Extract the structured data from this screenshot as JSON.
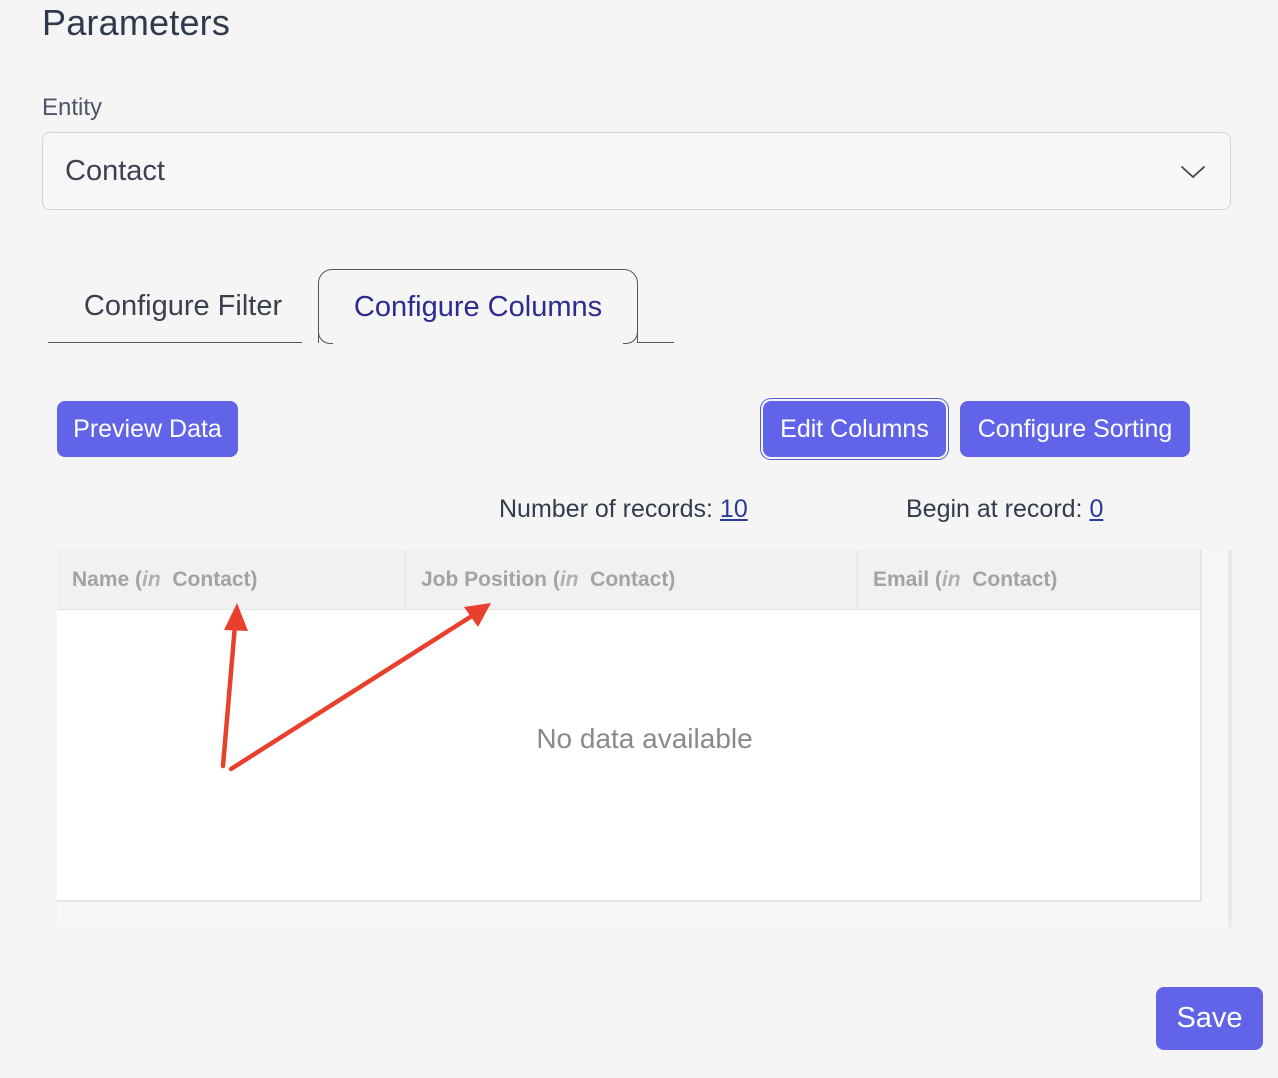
{
  "page": {
    "title": "Parameters"
  },
  "entity": {
    "label": "Entity",
    "selected": "Contact"
  },
  "tabs": [
    {
      "label": "Configure Filter",
      "active": false
    },
    {
      "label": "Configure Columns",
      "active": true
    }
  ],
  "toolbar": {
    "preview_label": "Preview Data",
    "edit_columns_label": "Edit Columns",
    "configure_sorting_label": "Configure Sorting"
  },
  "records": {
    "count_label": "Number of records: ",
    "count_value": "10",
    "begin_label": "Begin at record: ",
    "begin_value": "0"
  },
  "table": {
    "columns": [
      {
        "name": "Name",
        "in_word": "in",
        "entity": "Contact"
      },
      {
        "name": "Job Position",
        "in_word": "in",
        "entity": "Contact"
      },
      {
        "name": "Email",
        "in_word": "in",
        "entity": "Contact"
      }
    ],
    "empty_message": "No data available"
  },
  "footer": {
    "save_label": "Save"
  },
  "colors": {
    "accent": "#6163e8",
    "active_tab_text": "#2d2b8f",
    "annotation_arrow": "#e8402c"
  },
  "icons": {
    "select_chevron": "chevron-down-icon"
  }
}
